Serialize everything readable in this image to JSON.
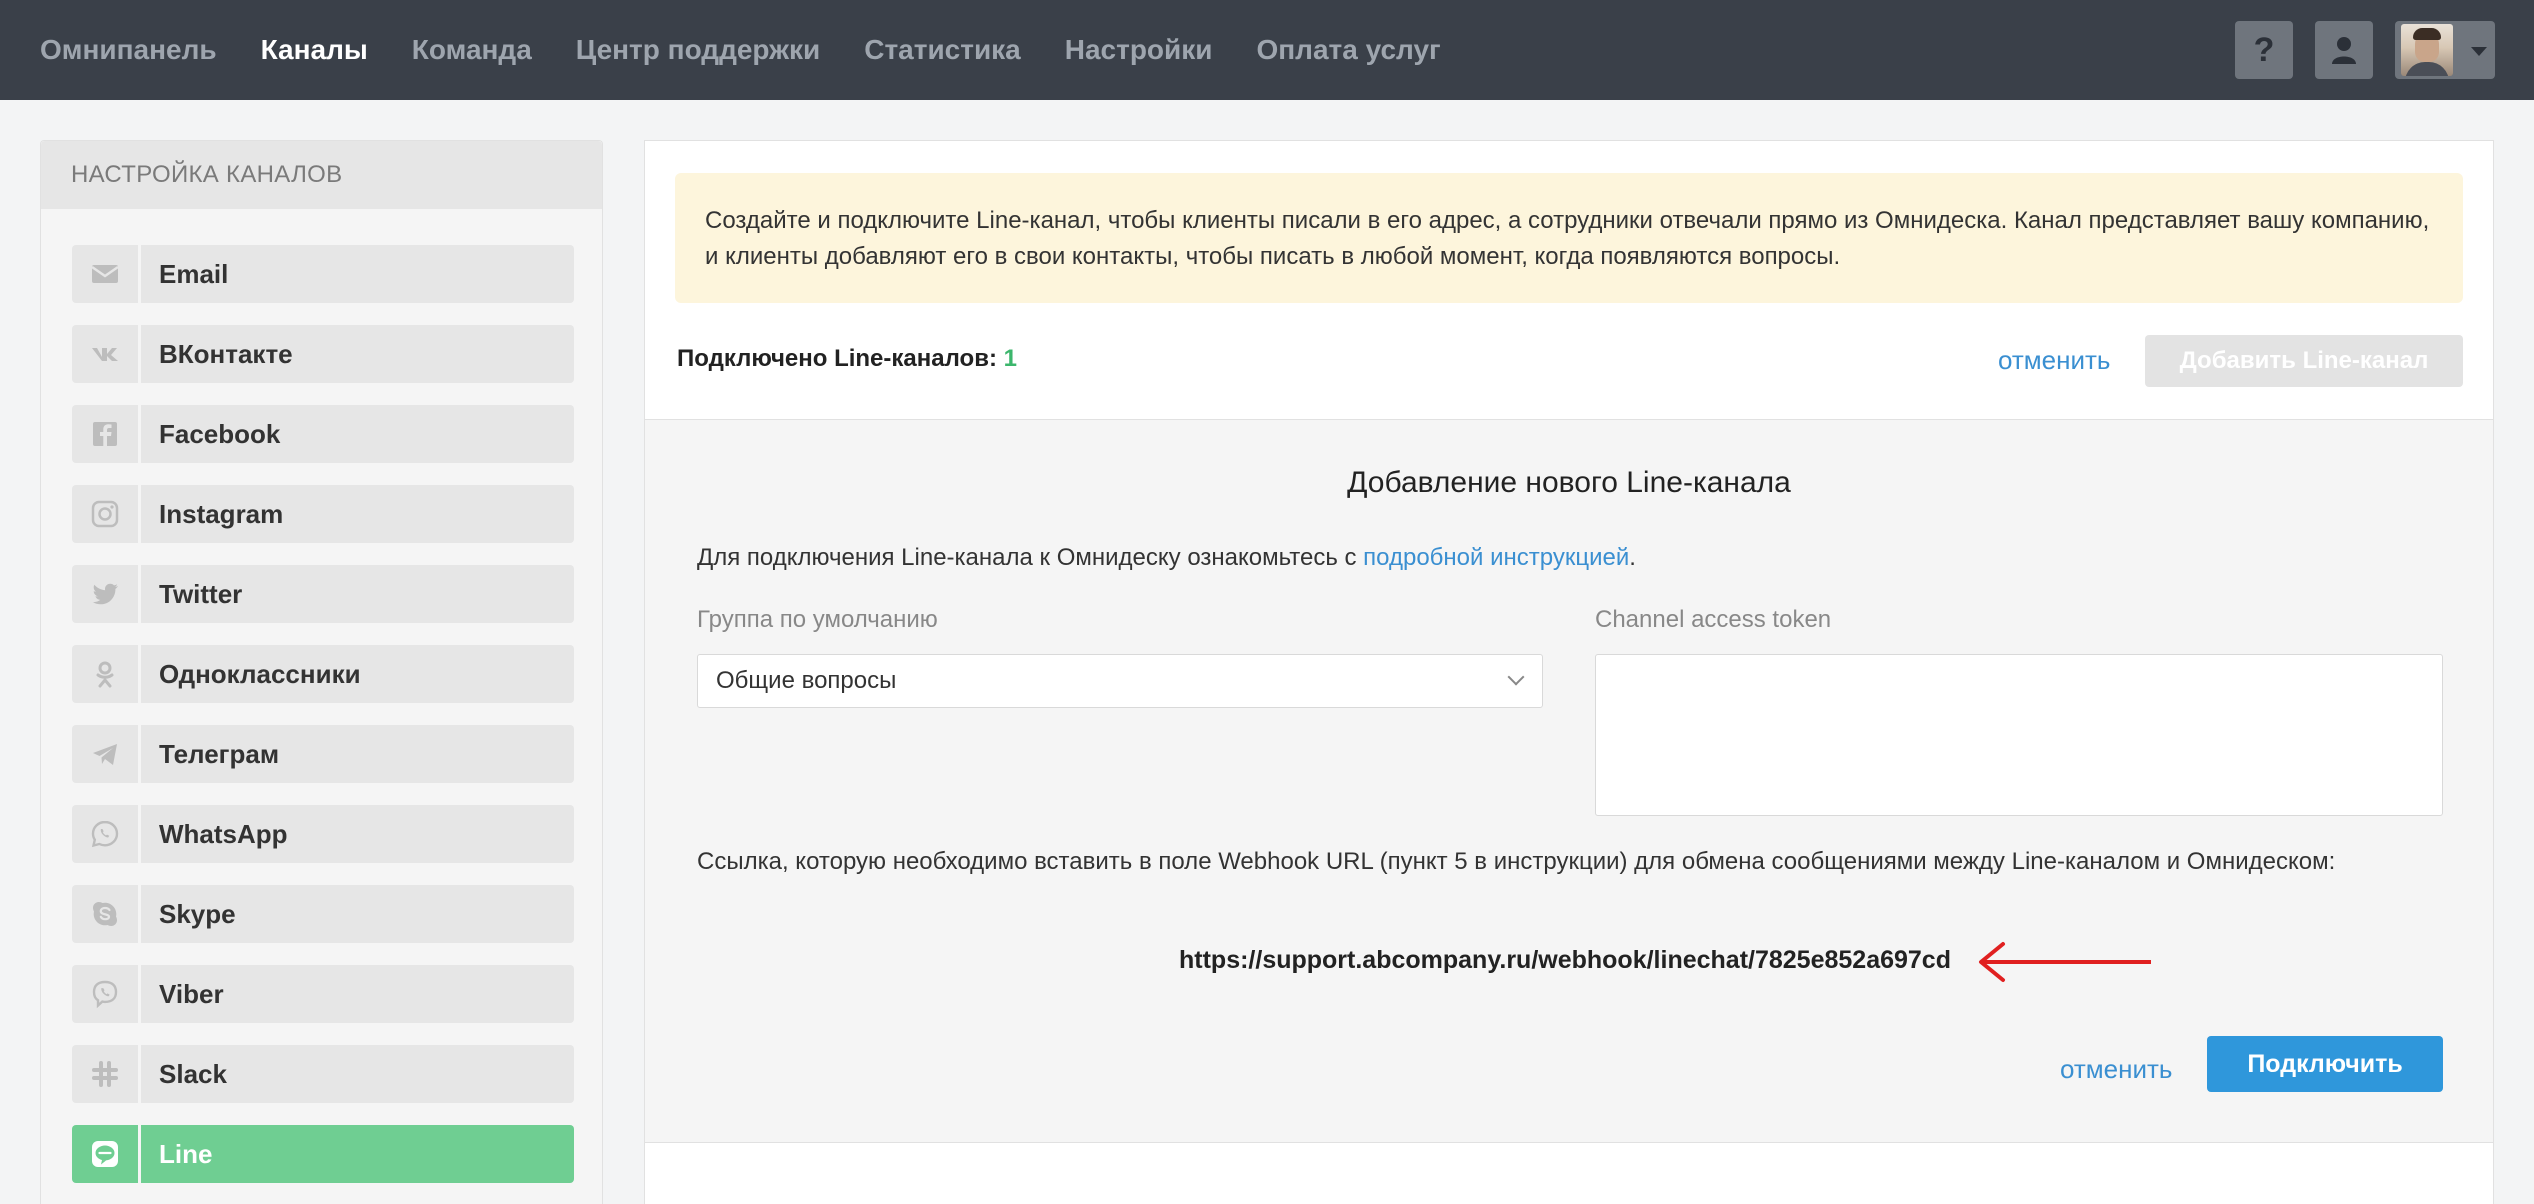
{
  "nav": {
    "items": [
      {
        "label": "Омнипанель",
        "active": false
      },
      {
        "label": "Каналы",
        "active": true
      },
      {
        "label": "Команда",
        "active": false
      },
      {
        "label": "Центр поддержки",
        "active": false
      },
      {
        "label": "Статистика",
        "active": false
      },
      {
        "label": "Настройки",
        "active": false
      },
      {
        "label": "Оплата услуг",
        "active": false
      }
    ],
    "help_label": "?"
  },
  "sidebar": {
    "title": "НАСТРОЙКА КАНАЛОВ",
    "items": [
      {
        "label": "Email",
        "icon": "email-icon"
      },
      {
        "label": "ВКонтакте",
        "icon": "vk-icon"
      },
      {
        "label": "Facebook",
        "icon": "facebook-icon"
      },
      {
        "label": "Instagram",
        "icon": "instagram-icon"
      },
      {
        "label": "Twitter",
        "icon": "twitter-icon"
      },
      {
        "label": "Одноклассники",
        "icon": "odnoklassniki-icon"
      },
      {
        "label": "Телеграм",
        "icon": "telegram-icon"
      },
      {
        "label": "WhatsApp",
        "icon": "whatsapp-icon"
      },
      {
        "label": "Skype",
        "icon": "skype-icon"
      },
      {
        "label": "Viber",
        "icon": "viber-icon"
      },
      {
        "label": "Slack",
        "icon": "slack-icon"
      },
      {
        "label": "Line",
        "icon": "line-icon",
        "active": true
      }
    ]
  },
  "main": {
    "notice": "Создайте и подключите Line-канал, чтобы клиенты писали в его адрес, а сотрудники отвечали прямо из Омнидеска. Канал представляет вашу компанию, и клиенты добавляют его в свои контакты, чтобы писать в любой момент, когда появляются вопросы.",
    "count_label": "Подключено Line-каналов:",
    "count_value": "1",
    "cancel_label": "отменить",
    "add_button_label": "Добавить Line-канал"
  },
  "form": {
    "title": "Добавление нового Line-канала",
    "intro_text": "Для подключения Line-канала к Омнидеску ознакомьтесь с ",
    "intro_link": "подробной инструкцией",
    "intro_end": ".",
    "group_label": "Группа по умолчанию",
    "group_value": "Общие вопросы",
    "token_label": "Channel access token",
    "token_value": "",
    "webhook_text": "Ссылка, которую необходимо вставить в поле Webhook URL (пункт 5 в инструкции) для обмена сообщениями между Line-каналом и Омнидеском:",
    "webhook_url": "https://support.abcompany.ru/webhook/linechat/7825e852a697cd",
    "cancel_label": "отменить",
    "connect_label": "Подключить"
  },
  "colors": {
    "topbar": "#3a4049",
    "active_channel": "#6fce92",
    "link": "#3a8fd1",
    "primary_button": "#2f97db",
    "arrow": "#e02020"
  }
}
